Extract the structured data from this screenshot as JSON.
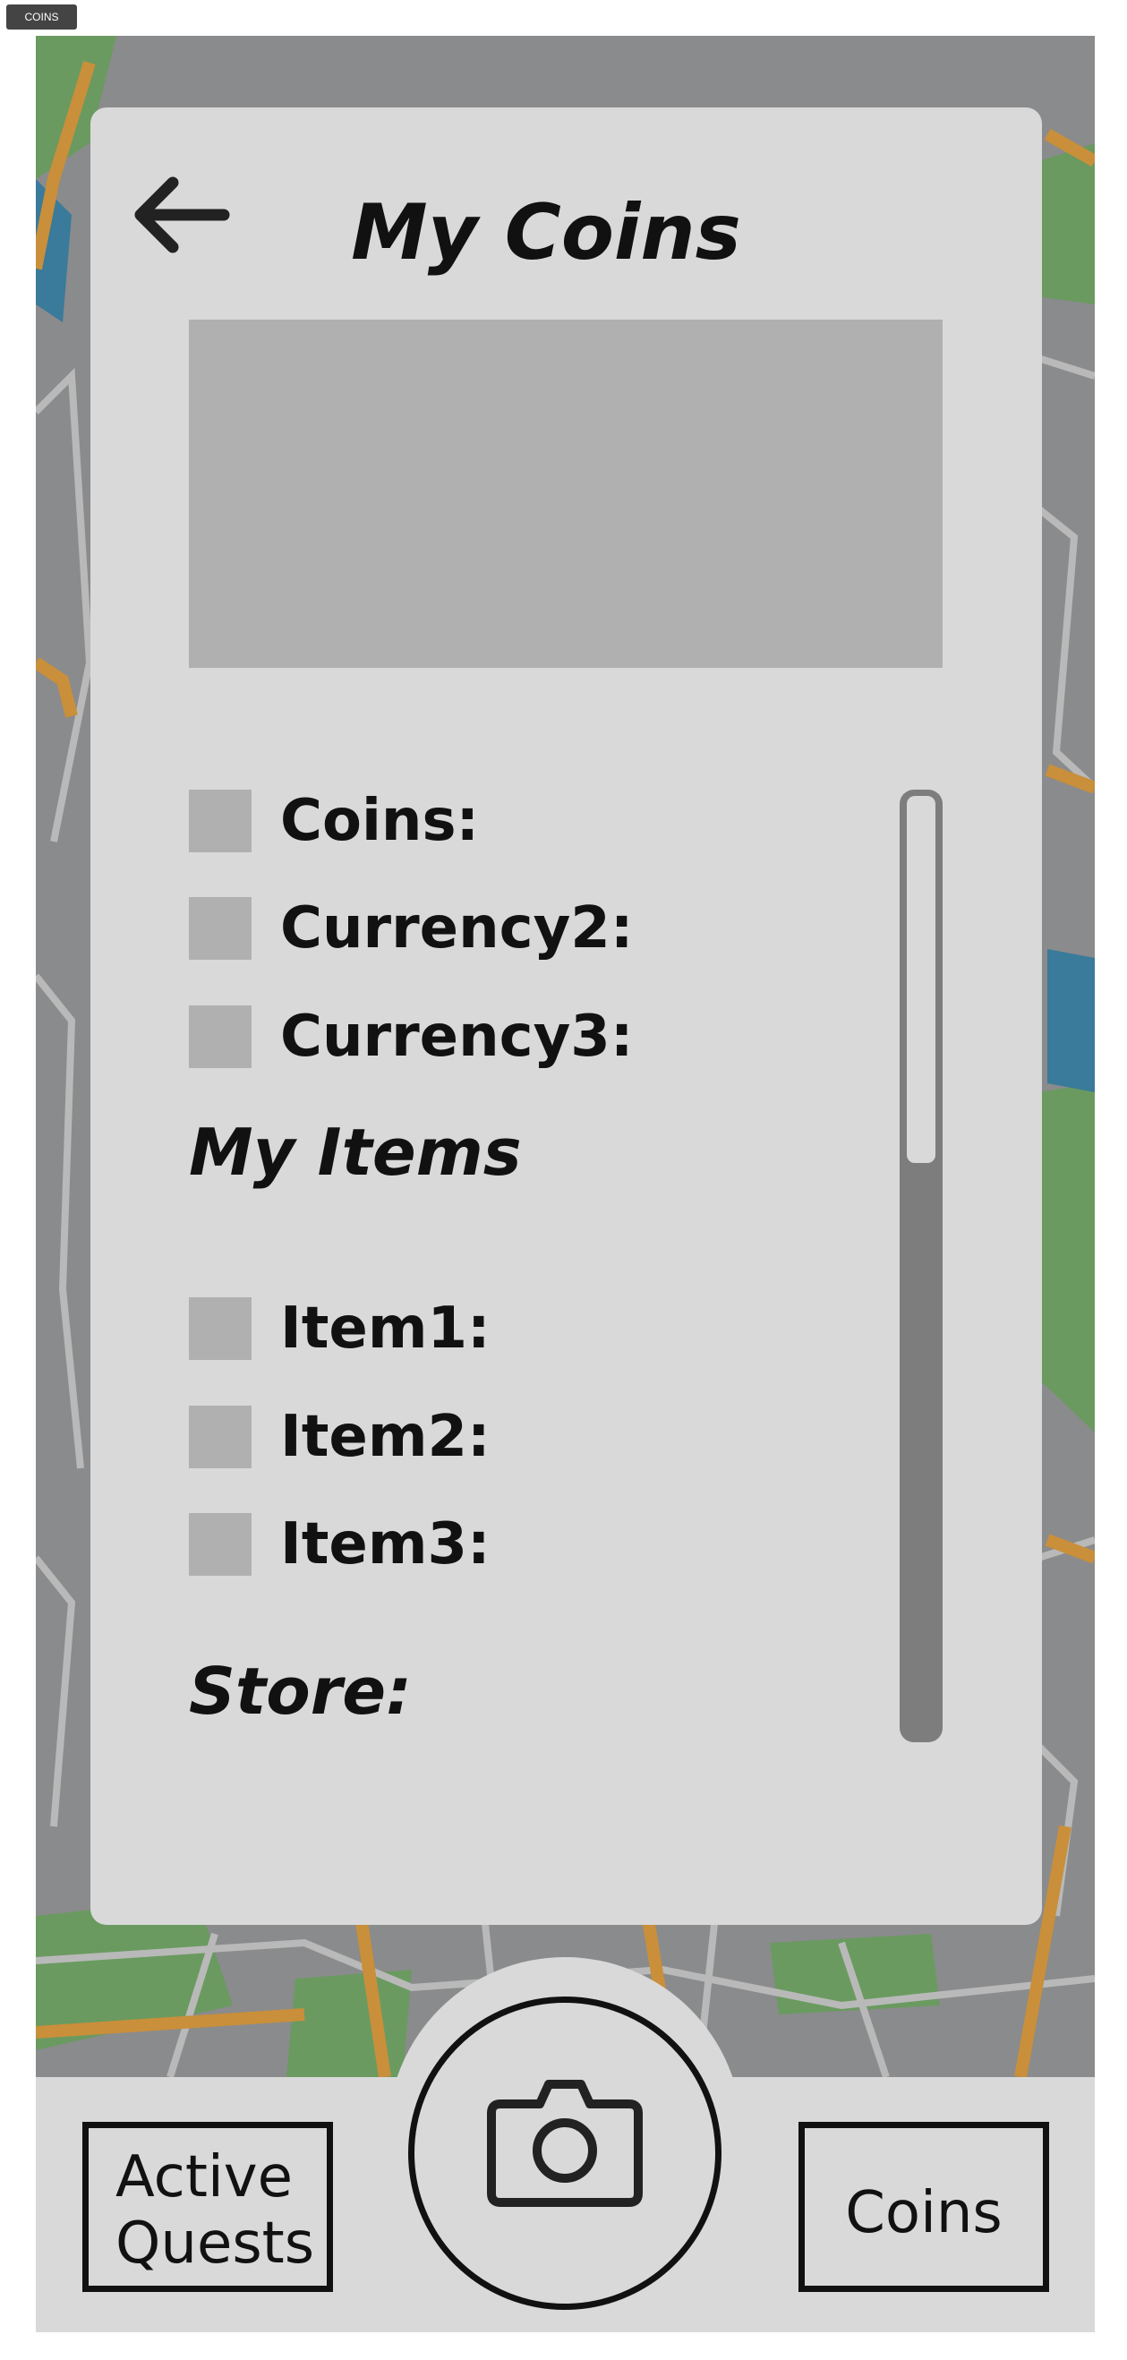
{
  "page_tag": "COINS",
  "header": {
    "back_icon": "arrow-left-icon",
    "title": "My Coins"
  },
  "currencies": [
    {
      "label": "Coins:"
    },
    {
      "label": "Currency2:"
    },
    {
      "label": "Currency3:"
    }
  ],
  "items_section": {
    "title": "My Items"
  },
  "items": [
    {
      "label": "Item1:"
    },
    {
      "label": "Item2:"
    },
    {
      "label": "Item3:"
    }
  ],
  "store_section": {
    "title": "Store:"
  },
  "bottom_nav": {
    "quests_label_line1": "Active",
    "quests_label_line2": "Quests",
    "coins_label": "Coins",
    "camera_icon": "camera-icon"
  },
  "colors": {
    "panel": "#d9d9d9",
    "placeholder": "#b0b0b0",
    "map_road": "#8a8b8c",
    "map_park": "#6a9a60",
    "map_major_road": "#c98f3a",
    "map_water": "#3a7a9a"
  }
}
